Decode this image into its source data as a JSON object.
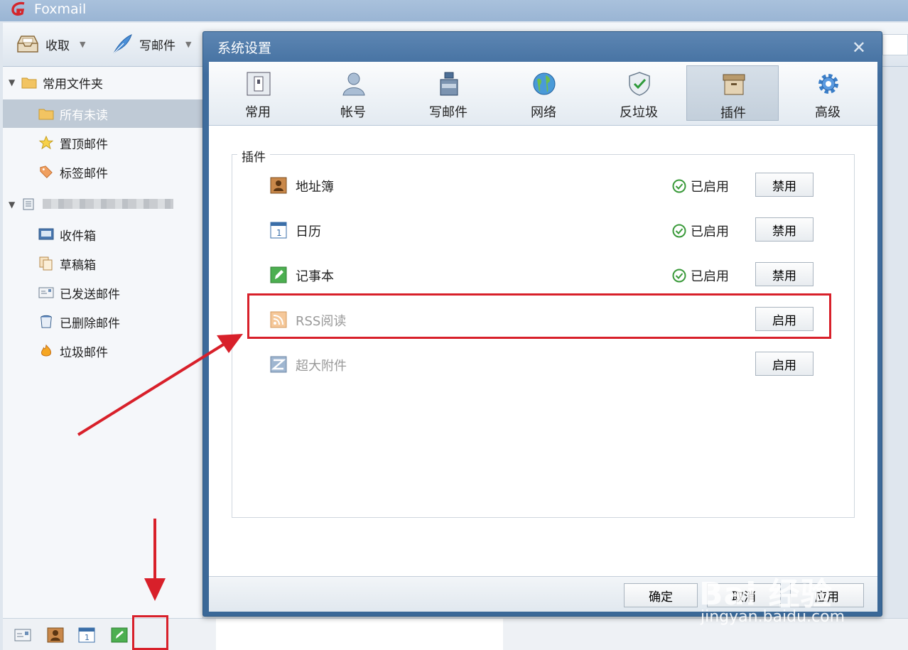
{
  "app": {
    "title": "Foxmail"
  },
  "toolbar": {
    "receive_label": "收取",
    "compose_label": "写邮件"
  },
  "sidebar": {
    "favorites_header": "常用文件夹",
    "favorites": [
      {
        "label": "所有未读",
        "icon": "folder-icon",
        "selected": true
      },
      {
        "label": "置顶邮件",
        "icon": "star-icon"
      },
      {
        "label": "标签邮件",
        "icon": "tag-icon"
      }
    ],
    "account_folders": [
      {
        "label": "收件箱",
        "icon": "inbox-icon"
      },
      {
        "label": "草稿箱",
        "icon": "drafts-icon"
      },
      {
        "label": "已发送邮件",
        "icon": "sent-icon"
      },
      {
        "label": "已删除邮件",
        "icon": "trash-icon"
      },
      {
        "label": "垃圾邮件",
        "icon": "junk-icon"
      }
    ]
  },
  "bottombar": {
    "icons": [
      "mail-icon",
      "contacts-icon",
      "calendar-icon",
      "notes-icon"
    ]
  },
  "dialog": {
    "title": "系统设置",
    "tabs": [
      {
        "label": "常用",
        "icon": "general-icon"
      },
      {
        "label": "帐号",
        "icon": "account-icon"
      },
      {
        "label": "写邮件",
        "icon": "compose-icon"
      },
      {
        "label": "网络",
        "icon": "network-icon"
      },
      {
        "label": "反垃圾",
        "icon": "antispam-icon"
      },
      {
        "label": "插件",
        "icon": "plugin-icon",
        "active": true
      },
      {
        "label": "高级",
        "icon": "advanced-icon"
      }
    ],
    "group_title": "插件",
    "plugins": [
      {
        "name": "地址簿",
        "status": "已启用",
        "button": "禁用",
        "enabled": true,
        "icon": "addressbook-icon"
      },
      {
        "name": "日历",
        "status": "已启用",
        "button": "禁用",
        "enabled": true,
        "icon": "calendar-icon"
      },
      {
        "name": "记事本",
        "status": "已启用",
        "button": "禁用",
        "enabled": true,
        "icon": "notepad-icon"
      },
      {
        "name": "RSS阅读",
        "status": "",
        "button": "启用",
        "enabled": false,
        "icon": "rss-icon"
      },
      {
        "name": "超大附件",
        "status": "",
        "button": "启用",
        "enabled": false,
        "icon": "large-attachment-icon"
      }
    ],
    "buttons": {
      "ok": "确定",
      "cancel": "取消",
      "apply": "应用"
    }
  },
  "watermark": {
    "brand": "Bai 经验",
    "url": "jingyan.baidu.com"
  },
  "colors": {
    "annotation": "#d8202a",
    "title_bar": "#3f6c9d",
    "ok_check": "#3a9a3a"
  }
}
